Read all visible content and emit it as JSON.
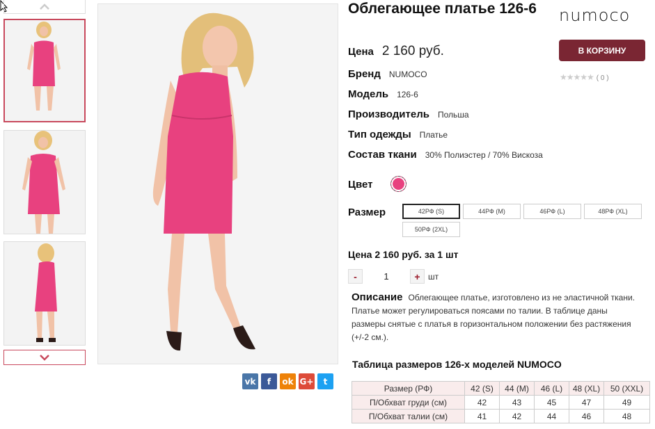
{
  "product": {
    "title": "Облегающее платье 126-6",
    "brand_logo": "numoco",
    "add_to_cart_label": "В КОРЗИНУ",
    "rating_stars": "★★★★★",
    "rating_count": "( 0 )",
    "price_label": "Цена",
    "price_value": "2 160 руб."
  },
  "attributes": [
    {
      "label": "Бренд",
      "value": "NUMOCO"
    },
    {
      "label": "Модель",
      "value": "126-6"
    },
    {
      "label": "Производитель",
      "value": "Польша"
    },
    {
      "label": "Тип одежды",
      "value": "Платье"
    },
    {
      "label": "Состав ткани",
      "value": "30% Полиэстер / 70% Вискоза"
    }
  ],
  "color": {
    "label": "Цвет",
    "swatch": "#e8417f"
  },
  "size": {
    "label": "Размер",
    "options": [
      "42РФ (S)",
      "44РФ (M)",
      "46РФ (L)",
      "48РФ (XL)",
      "50РФ (2XL)"
    ],
    "selected": "42РФ (S)"
  },
  "order": {
    "price_line": "Цена 2 160 руб. за 1 шт",
    "minus": "-",
    "quantity": "1",
    "plus": "+",
    "unit": "шт"
  },
  "description": {
    "label": "Описание",
    "text": "Облегающее платье, изготовлено из не эластичной ткани. Платье может регулироваться поясами по талии.  В таблице даны размеры снятые с платья в горизонтальном положении без растяжения (+/-2 см.)."
  },
  "size_table": {
    "title": "Таблица размеров 126-х моделей NUMOCO",
    "header": [
      "Размер (РФ)",
      "42 (S)",
      "44 (M)",
      "46 (L)",
      "48 (XL)",
      "50 (XXL)"
    ],
    "rows": [
      [
        "П/Обхват груди (см)",
        "42",
        "43",
        "45",
        "47",
        "49"
      ],
      [
        "П/Обхват талии (см)",
        "41",
        "42",
        "44",
        "46",
        "48"
      ]
    ]
  },
  "share": {
    "buttons": [
      {
        "name": "vk",
        "glyph": "vk",
        "color": "#4a76a8"
      },
      {
        "name": "facebook",
        "glyph": "f",
        "color": "#3b5998"
      },
      {
        "name": "odnoklassniki",
        "glyph": "ok",
        "color": "#ee8208"
      },
      {
        "name": "google-plus",
        "glyph": "G+",
        "color": "#dd4b39"
      },
      {
        "name": "twitter",
        "glyph": "t",
        "color": "#1da1f2"
      }
    ]
  },
  "colors": {
    "accent": "#7a2633",
    "thumb_border": "#c8485c",
    "dress": "#e8417f"
  }
}
